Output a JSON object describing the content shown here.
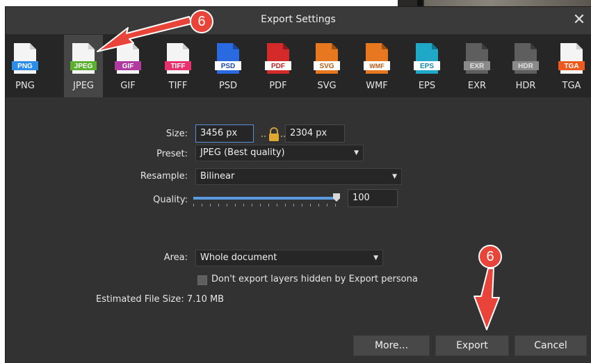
{
  "dialog": {
    "title": "Export Settings",
    "close_glyph": "✕"
  },
  "formats": [
    {
      "label": "PNG",
      "badge": "PNG",
      "color": "#2a8ee8",
      "selected": false
    },
    {
      "label": "JPEG",
      "badge": "JPEG",
      "color": "#5bb02e",
      "selected": true
    },
    {
      "label": "GIF",
      "badge": "GIF",
      "color": "#b03aa0",
      "selected": false
    },
    {
      "label": "TIFF",
      "badge": "TIFF",
      "color": "#e8306e",
      "selected": false
    },
    {
      "label": "PSD",
      "badge": "PSD",
      "color": "#2a6ae0",
      "selected": false
    },
    {
      "label": "PDF",
      "badge": "PDF",
      "color": "#d42a2a",
      "selected": false
    },
    {
      "label": "SVG",
      "badge": "SVG",
      "color": "#e87820",
      "selected": false
    },
    {
      "label": "WMF",
      "badge": "WMF",
      "color": "#e87820",
      "selected": false
    },
    {
      "label": "EPS",
      "badge": "EPS",
      "color": "#20a8c8",
      "selected": false
    },
    {
      "label": "EXR",
      "badge": "EXR",
      "color": "#5e5e5e",
      "selected": false
    },
    {
      "label": "HDR",
      "badge": "HDR",
      "color": "#5e5e5e",
      "selected": false
    },
    {
      "label": "TGA",
      "badge": "TGA",
      "color": "#ee5a1e",
      "selected": false
    }
  ],
  "form": {
    "size_label": "Size:",
    "width_value": "3456 px",
    "height_value": "2304 px",
    "preset_label": "Preset:",
    "preset_value": "JPEG (Best quality)",
    "resample_label": "Resample:",
    "resample_value": "Bilinear",
    "quality_label": "Quality:",
    "quality_value": "100",
    "quality_level": 1.0,
    "area_label": "Area:",
    "area_value": "Whole document",
    "hidden_layers_label": "Don't export layers hidden by Export persona",
    "hidden_layers_checked": false,
    "estimated_size": "Estimated File Size: 7.10 MB"
  },
  "buttons": {
    "more": "More...",
    "export": "Export",
    "cancel": "Cancel"
  },
  "annotations": {
    "step_number_top": "6",
    "step_number_bottom": "6",
    "callout_color": "#e8443a"
  },
  "icons": [
    "lock-icon",
    "caret-down-icon",
    "close-icon",
    "file-format-icon"
  ]
}
